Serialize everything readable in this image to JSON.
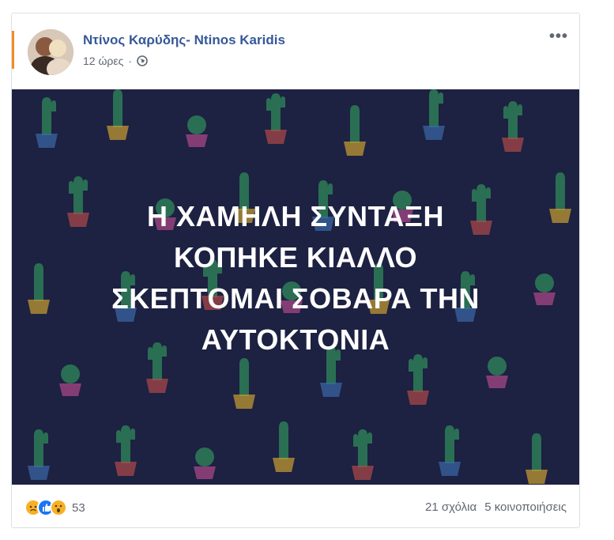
{
  "post": {
    "author": "Ντίνος Καρύδης- Ntinos Karidis",
    "time": "12 ώρες",
    "separator": "·",
    "image_text_lines": [
      "Η ΧΑΜΗΛΗ ΣΥΝΤΑΞΗ",
      "ΚΟΠΗΚΕ ΚΙΑΛΛΟ",
      "ΣΚΕΠΤΟΜΑΙ ΣΟΒΑΡΑ ΤΗΝ",
      "ΑΥΤΟΚΤΟΝΙΑ"
    ],
    "more_label": "•••"
  },
  "footer": {
    "reaction_count": "53",
    "reactions": [
      "sad-icon",
      "like-icon",
      "wow-icon"
    ],
    "comments": "21 σχόλια",
    "shares": "5 κοινοποιήσεις"
  },
  "colors": {
    "author": "#365899",
    "image_bg": "#1d2142",
    "accent": "#f28c28"
  }
}
